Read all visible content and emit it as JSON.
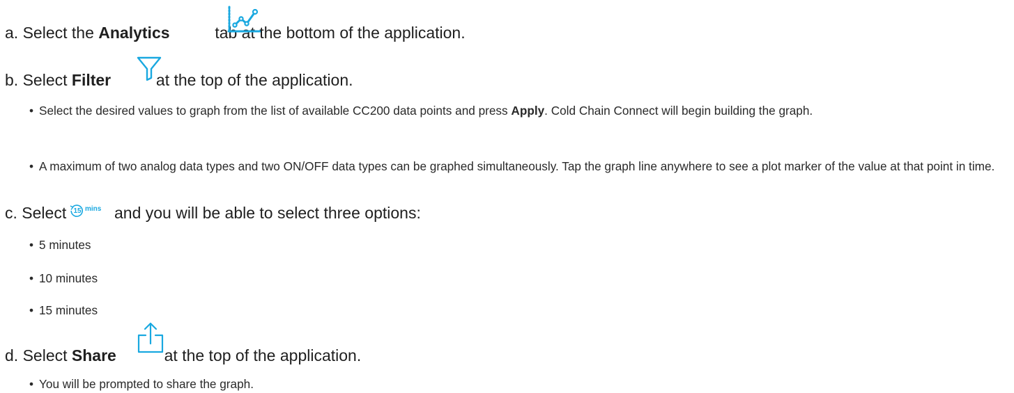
{
  "steps": {
    "a": {
      "letter": "a.",
      "pre": "Select the",
      "bold": "Analytics",
      "post": "tab at the bottom of the application."
    },
    "b": {
      "letter": "b.",
      "pre": "Select",
      "bold": "Filter",
      "post": "at the top of the application."
    },
    "c": {
      "letter": "c.",
      "pre": "Select",
      "post": "and you will be able to select three options:"
    },
    "d": {
      "letter": "d.",
      "pre": "Select",
      "bold": "Share",
      "post": "at the top of the application."
    }
  },
  "bullets_b": [
    {
      "pre": "Select the desired values to graph from the list of available CC200 data points and press",
      "bold": "Apply",
      "post": ". Cold Chain Connect will begin building the graph."
    },
    {
      "text": "A maximum of two analog data types and two ON/OFF data types can be graphed simultaneously. Tap the graph line anywhere to see a plot marker of the value at that point in time."
    }
  ],
  "timer_icon": {
    "number": "15",
    "unit": "mins"
  },
  "bullets_c": [
    "5 minutes",
    "10 minutes",
    "15 minutes"
  ],
  "bullets_d": [
    "You will be prompted to share the graph."
  ],
  "bullet_char": "•",
  "icons": {
    "analytics": "analytics-chart-icon",
    "filter": "filter-funnel-icon",
    "timer": "timer-15-mins-icon",
    "share": "share-upload-icon"
  },
  "colors": {
    "icon_blue": "#19a8e0",
    "text": "#222222"
  }
}
